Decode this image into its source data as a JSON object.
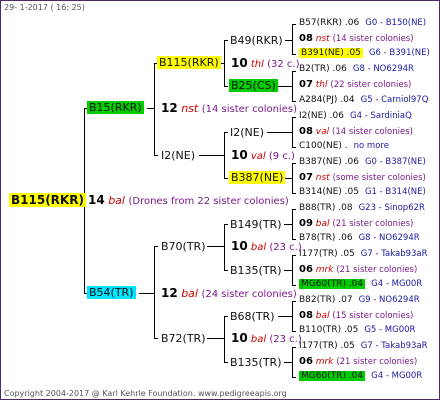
{
  "header": {
    "date": "29- 1-2017 ( 16: 25)"
  },
  "footer": {
    "copyright": "Copyright 2004-2017 @ Karl Kehrle Foundation.   www.pedigreeapis.org"
  },
  "root": {
    "label": "B115(RKR)",
    "num": "14",
    "code": "bal",
    "note": "(Drones from 22 sister colonies)"
  },
  "colors": {
    "yellow": "#ffff00",
    "green": "#00cc00",
    "cyan": "#00e5ff",
    "red": "#cc0000",
    "purple": "#7a1a8a"
  },
  "gen1": {
    "upper": {
      "label": "B15(RKR)",
      "num": "12",
      "code": "nst",
      "note": "(14 sister colonies)"
    },
    "lower": {
      "label": "B54(TR)",
      "num": "12",
      "code": "bal",
      "note": "(24 sister colonies)"
    }
  },
  "gen2": {
    "b115": {
      "label": "B115(RKR)",
      "num": "10",
      "code": "thl",
      "note": "(32 c.)"
    },
    "i2": {
      "label": "I2(NE)",
      "num": "10",
      "code": "val",
      "note": "(9 c.)"
    },
    "b70": {
      "label": "B70(TR)",
      "num": "10",
      "code": "bal",
      "note": "(23 c.)"
    },
    "b72": {
      "label": "B72(TR)",
      "num": "10",
      "code": "bal",
      "note": "(23 c.)"
    }
  },
  "gen3": {
    "b49": "B49(RKR)",
    "b25": "B25(CS)",
    "i2b": "I2(NE)",
    "b387": "B387(NE)",
    "b149": "B149(TR)",
    "b135a": "B135(TR)",
    "b68": "B68(TR)",
    "b135b": "B135(TR)"
  },
  "leaves": [
    {
      "a": "B57(RKR) .06",
      "b": "G0 - B150(NE)"
    },
    {
      "num": "08",
      "code": "nst",
      "note": "(14 sister colonies)"
    },
    {
      "a": "B391(NE) .05",
      "b": "G6 - B391(NE)"
    },
    {
      "a": "B2(TR) .06",
      "b": "G8 - NO6294R"
    },
    {
      "num": "07",
      "code": "thl",
      "note": "(22 sister colonies)"
    },
    {
      "a": "A284(PJ) .04",
      "b": "G5 - Carniol97Q"
    },
    {
      "a": "I2(NE) .06",
      "b": "G4 - SardiniaQ"
    },
    {
      "num": "08",
      "code": "val",
      "note": "(14 sister colonies)"
    },
    {
      "a": "C100(NE) .",
      "b": "no more"
    },
    {
      "a": "B387(NE) .06",
      "b": "G0 - B387(NE)"
    },
    {
      "num": "07",
      "code": "nst",
      "note": "(some sister colonies)"
    },
    {
      "a": "B314(NE) .05",
      "b": "G1 - B314(NE)"
    },
    {
      "a": "B88(TR) .08",
      "b": "G23 - Sinop62R"
    },
    {
      "num": "09",
      "code": "bal",
      "note": "(21 sister colonies)"
    },
    {
      "a": "B78(TR) .06",
      "b": "G8 - NO6294R"
    },
    {
      "a": "I177(TR) .05",
      "b": "G7 - Takab93aR"
    },
    {
      "num": "06",
      "code": "mrk",
      "note": "(21 sister colonies)"
    },
    {
      "a": "MG60(TR) .04",
      "b": "G4 - MG00R"
    },
    {
      "a": "B82(TR) .07",
      "b": "G9 - NO6294R"
    },
    {
      "num": "08",
      "code": "bal",
      "note": "(15 sister colonies)"
    },
    {
      "a": "B110(TR) .05",
      "b": "G5 - MG00R"
    },
    {
      "a": "I177(TR) .05",
      "b": "G7 - Takab93aR"
    },
    {
      "num": "06",
      "code": "mrk",
      "note": "(21 sister colonies)"
    },
    {
      "a": "MG60(TR) .04",
      "b": "G4 - MG00R"
    }
  ]
}
